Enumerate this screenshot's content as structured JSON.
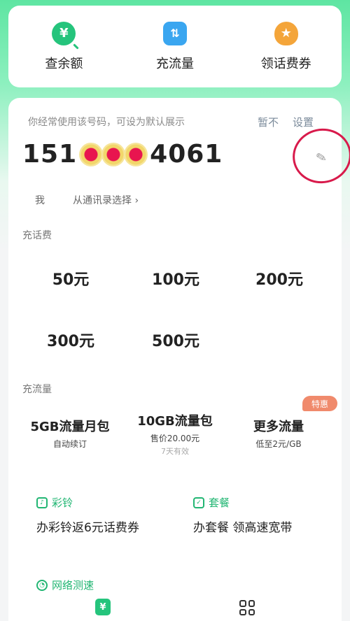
{
  "quick_actions": [
    {
      "label": "查余额",
      "icon": "balance-search-icon",
      "glyph": "¥"
    },
    {
      "label": "充流量",
      "icon": "data-transfer-icon",
      "glyph": "⇅"
    },
    {
      "label": "领话费券",
      "icon": "coupon-bag-icon",
      "glyph": "★"
    }
  ],
  "number_card": {
    "hint": "你经常使用该号码，可设为默认展示",
    "not_now": "暂不",
    "set": "设置",
    "phone_prefix": "151",
    "phone_suffix": "4061",
    "owner": "我",
    "pick_contacts": "从通讯录选择 ›"
  },
  "recharge": {
    "title": "充话费",
    "amounts": [
      "50元",
      "100元",
      "200元",
      "300元",
      "500元"
    ]
  },
  "data_packs": {
    "title": "充流量",
    "badge": "特惠",
    "items": [
      {
        "name": "5GB流量月包",
        "sub": "自动续订",
        "sub2": ""
      },
      {
        "name": "10GB流量包",
        "sub": "售价20.00元",
        "sub2": "7天有效"
      },
      {
        "name": "更多流量",
        "sub": "低至2元/GB",
        "sub2": ""
      }
    ]
  },
  "features": [
    {
      "title": "彩铃",
      "desc": "办彩铃返6元话费券",
      "icon": "music-note-icon"
    },
    {
      "title": "套餐",
      "desc": "办套餐 领高速宽带",
      "icon": "package-check-icon"
    },
    {
      "title": "网络测速",
      "desc": "",
      "icon": "speed-test-icon"
    }
  ],
  "tabbar": {
    "home_glyph": "¥"
  },
  "colors": {
    "accent": "#25c47c",
    "mask_red": "#e8154f",
    "circle": "#d81a4b",
    "badge": "#f08a6c"
  }
}
